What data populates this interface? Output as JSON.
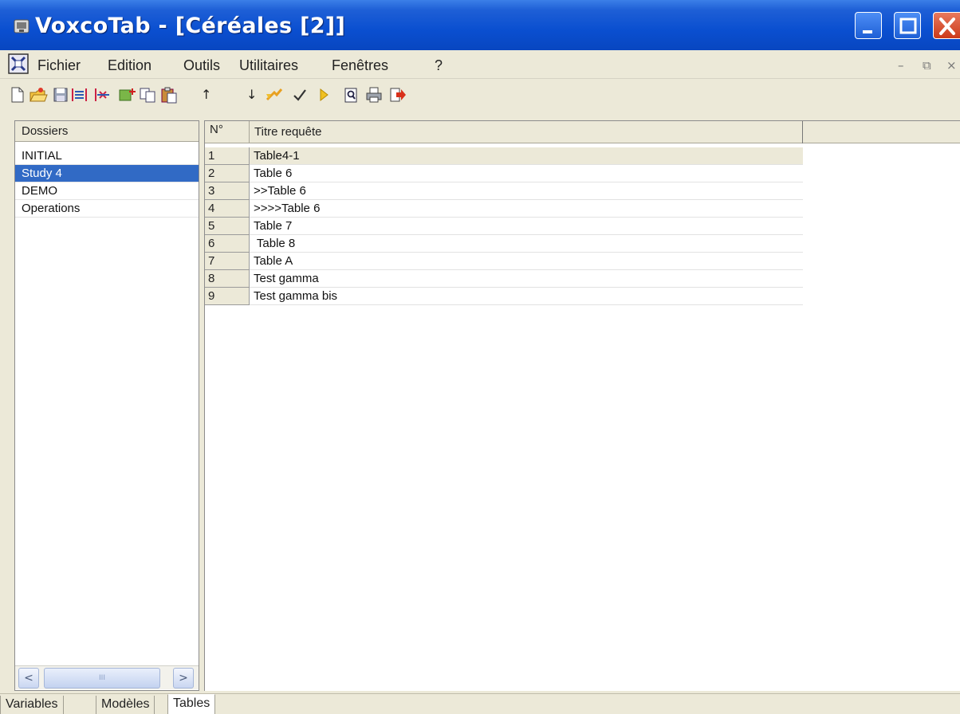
{
  "window": {
    "title": "VoxcoTab - [Céréales [2]]",
    "controls": {
      "minimize": "minimize",
      "maximize": "maximize",
      "close": "close"
    }
  },
  "menu": {
    "items": [
      "Fichier",
      "Edition",
      "Outils",
      "Utilitaires",
      "Fenêtres",
      "?"
    ]
  },
  "toolbar": {
    "icons": [
      "new-document-icon",
      "open-folder-icon",
      "save-icon",
      "columns-icon",
      "delete-columns-icon",
      "add-table-icon",
      "copy-icon",
      "paste-icon",
      "move-up-icon",
      "move-down-icon",
      "run-all-icon",
      "check-icon",
      "play-icon",
      "view-icon",
      "print-icon",
      "export-icon"
    ],
    "up_arrow": "↑",
    "down_arrow": "↓"
  },
  "left_pane": {
    "header": "Dossiers",
    "folders": [
      "INITIAL",
      "Study 4",
      "DEMO",
      "Operations"
    ],
    "selected_index": 1,
    "scroll_left": "<",
    "scroll_right": ">",
    "thumb_grip": "III"
  },
  "table": {
    "columns": [
      "N°",
      "Titre requête"
    ],
    "current_row_index": 0,
    "rows": [
      {
        "num": "1",
        "title": "Table4-1"
      },
      {
        "num": "2",
        "title": "Table 6"
      },
      {
        "num": "3",
        "title": ">>Table 6"
      },
      {
        "num": "4",
        "title": ">>>>Table 6"
      },
      {
        "num": "5",
        "title": "Table 7"
      },
      {
        "num": "6",
        "title": " Table 8"
      },
      {
        "num": "7",
        "title": "Table A"
      },
      {
        "num": "8",
        "title": "Test gamma"
      },
      {
        "num": "9",
        "title": "Test gamma bis"
      }
    ]
  },
  "bottom_tabs": {
    "items": [
      "Variables",
      "Modèles",
      "Tables"
    ],
    "active_index": 2
  },
  "colors": {
    "titlebar": "#0a4fd0",
    "selection": "#316ac5",
    "chrome": "#ece9d8"
  }
}
